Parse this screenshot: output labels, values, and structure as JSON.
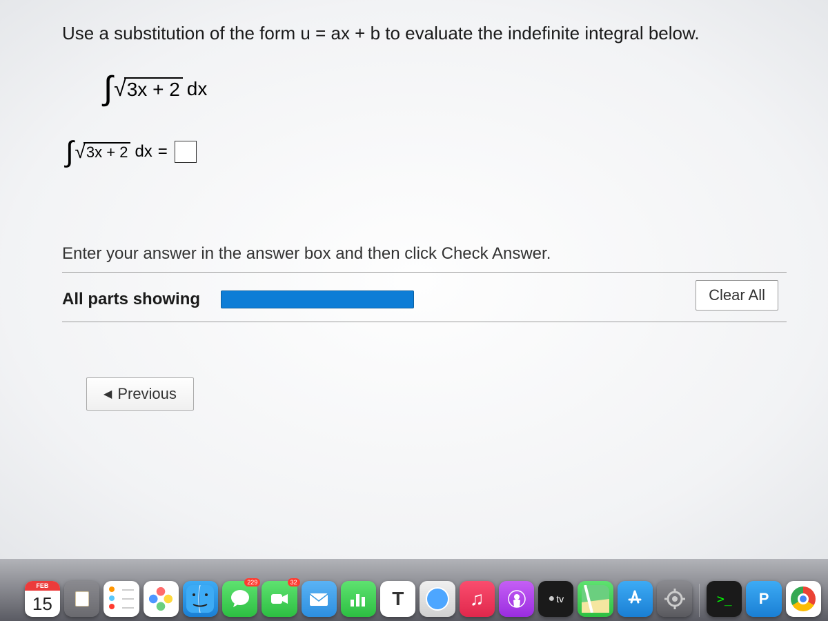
{
  "question": {
    "prompt": "Use a substitution of the form u = ax + b to evaluate the indefinite integral below.",
    "integrand_under_sqrt": "3x + 2",
    "differential": "dx",
    "equals": "=",
    "instruction": "Enter your answer in the answer box and then click Check Answer.",
    "parts_label": "All parts showing"
  },
  "buttons": {
    "clear_all": "Clear All",
    "previous": "Previous"
  },
  "dock": {
    "calendar_month": "FEB",
    "calendar_day": "15",
    "messages_badge": "229",
    "facetime_badge": "32",
    "tv_label": "tv"
  }
}
